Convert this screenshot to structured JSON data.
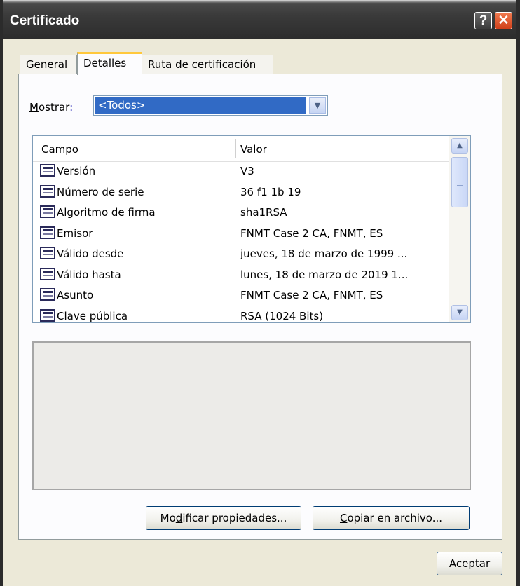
{
  "window": {
    "title": "Certificado"
  },
  "titlebar": {
    "help_glyph": "?",
    "close_glyph": "✕"
  },
  "tabs": [
    {
      "label": "General",
      "active": false
    },
    {
      "label": "Detalles",
      "active": true
    },
    {
      "label": "Ruta de certificación",
      "active": false
    }
  ],
  "mostrar": {
    "label_underlined": "M",
    "label_rest": "ostrar",
    "colon": ":",
    "selected": "<Todos>"
  },
  "list": {
    "columns": [
      "Campo",
      "Valor"
    ],
    "rows": [
      {
        "field": "Versión",
        "value": "V3"
      },
      {
        "field": "Número de serie",
        "value": "36 f1 1b 19"
      },
      {
        "field": "Algoritmo de firma",
        "value": "sha1RSA"
      },
      {
        "field": "Emisor",
        "value": "FNMT Case 2 CA, FNMT, ES"
      },
      {
        "field": "Válido desde",
        "value": "jueves, 18 de marzo de 1999 ..."
      },
      {
        "field": "Válido hasta",
        "value": "lunes, 18 de marzo de 2019 1..."
      },
      {
        "field": "Asunto",
        "value": "FNMT Case 2 CA, FNMT, ES"
      },
      {
        "field": "Clave pública",
        "value": "RSA (1024 Bits)"
      }
    ]
  },
  "buttons": {
    "modify_pre": "Mo",
    "modify_ul": "d",
    "modify_post": "ificar propiedades...",
    "copy_ul": "C",
    "copy_post": "opiar en archivo...",
    "ok": "Aceptar"
  },
  "icons": {
    "row_icon": "certificate-field-icon",
    "scroll_up": "scroll-up-arrow-icon",
    "scroll_down": "scroll-down-arrow-icon",
    "dropdown": "dropdown-arrow-icon"
  },
  "colors": {
    "titlebar": "#3a3a3a",
    "close_button": "#d0401a",
    "selection": "#316ac5",
    "tab_highlight": "#ffc83c",
    "dialog_background": "#ece9d8"
  }
}
